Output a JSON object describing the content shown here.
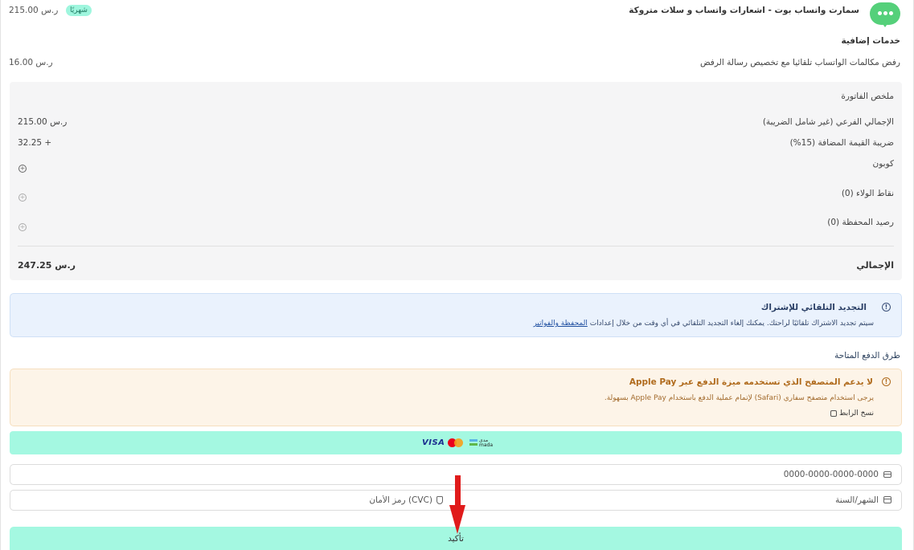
{
  "product": {
    "title": "سمارت واتساب بوت - اشعارات واتساب و سلات متروكة",
    "billing_badge": "شهريًا",
    "price": "215.00 ر.س",
    "logo_icon": "chat-bot-logo-icon"
  },
  "addons": {
    "section_title": "خدمات إضافية",
    "items": [
      {
        "name": "رفض مكالمات الواتساب تلقائيا مع تخصيص رسالة الرفض",
        "price": "16.00 ر.س"
      }
    ]
  },
  "invoice": {
    "title": "ملخص الفاتورة",
    "subtotal_label": "الإجمالي الفرعي (غير شامل الضريبة)",
    "subtotal_value": "215.00 ر.س",
    "vat_label": "ضريبة القيمة المضافة (15%)",
    "vat_value": "32.25 +",
    "coupon_label": "كوبون",
    "loyalty_label": "نقاط الولاء (0)",
    "wallet_label": "رصيد المحفظة (0)",
    "add_icon": "circle-plus-icon",
    "total_label": "الإجمالي",
    "total_value": "247.25 ر.س"
  },
  "auto_renew": {
    "title": "التجديد التلقائي للإشتراك",
    "text": "سيتم تجديد الاشتراك تلقائيًا لراحتك. يمكنك إلغاء التجديد التلقائي في أي وقت من خلال إعدادات",
    "link": "المحفظة والفواتير",
    "icon": "alert-triangle-icon"
  },
  "payment": {
    "section_title": "طرق الدفع المتاحة",
    "warning_title": "لا يدعم المتصفح الذي تستخدمه ميزة الدفع عبر Apple Pay",
    "warning_text": "يرجى استخدام متصفح سفاري (Safari) لإتمام عملية الدفع باستخدام Apple Pay بسهولة.",
    "copy_link": "نسخ الرابط",
    "brands": {
      "visa": "VISA",
      "mada": "مدى mada"
    },
    "card_number_placeholder": "0000-0000-0000-0000",
    "expiry_placeholder": "الشهر/السنة",
    "cvc_placeholder": "رمز الأمان (CVC)",
    "confirm_label": "تأكيد"
  },
  "colors": {
    "accent": "#a4f8e1",
    "badge_bg": "#9ff6de",
    "info_bg": "#eaf2fd",
    "warning_bg": "#fdf4e8",
    "arrow": "#e01b1b",
    "logo": "#55d07a"
  }
}
